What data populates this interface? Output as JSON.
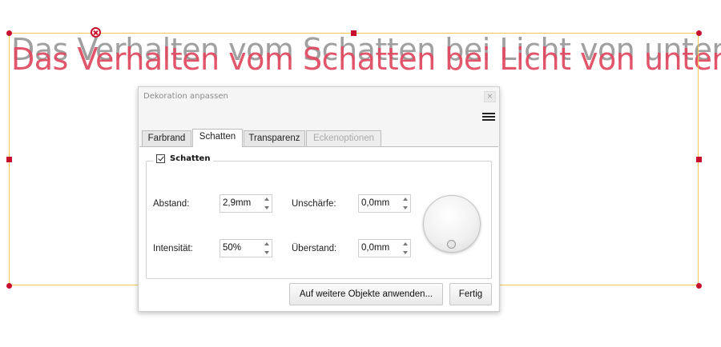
{
  "canvas": {
    "text_shadow": "Das Verhalten vom Schatten bei Licht von unten",
    "text_main": "Das Verhalten vom Schatten bei Licht von unten",
    "accent_color": "#c8102e",
    "frame_color": "#f2c94c"
  },
  "dialog": {
    "title": "Dekoration anpassen",
    "close_icon": "close-icon",
    "menu_icon": "hamburger-menu-icon",
    "tabs": [
      {
        "label": "Farbrand",
        "active": false,
        "disabled": false
      },
      {
        "label": "Schatten",
        "active": true,
        "disabled": false
      },
      {
        "label": "Transparenz",
        "active": false,
        "disabled": false
      },
      {
        "label": "Eckenoptionen",
        "active": false,
        "disabled": true
      }
    ],
    "group": {
      "checkbox_label": "Schatten",
      "checked": true
    },
    "fields": {
      "abstand": {
        "label": "Abstand:",
        "value": "2,9mm"
      },
      "intensitaet": {
        "label": "Intensität:",
        "value": "50%"
      },
      "unschaerfe": {
        "label": "Unschärfe:",
        "value": "0,0mm"
      },
      "ueberstand": {
        "label": "Überstand:",
        "value": "0,0mm"
      }
    },
    "buttons": {
      "apply_label": "Auf weitere Objekte anwenden...",
      "done_label": "Fertig"
    }
  }
}
